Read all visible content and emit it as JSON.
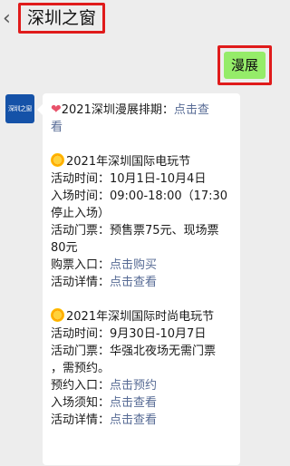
{
  "header": {
    "back_glyph": "‹",
    "title": "深圳之窗"
  },
  "outgoing": {
    "text": "漫展"
  },
  "avatar": {
    "label": "深圳之窗"
  },
  "message": {
    "intro_prefix": "2021深圳漫展排期：",
    "intro_link_part1": "点击查",
    "intro_link_part2": "看",
    "event1": {
      "title": "2021年深圳国际电玩节",
      "time": "活动时间：10月1日-10月4日",
      "entry_line1": "入场时间：09:00-18:00（17:30",
      "entry_line2": "停止入场）",
      "tickets_line1": "活动门票：预售票75元、现场票",
      "tickets_line2": "80元",
      "buy_label": "购票入口：",
      "buy_link": "点击购买",
      "detail_label": "活动详情：",
      "detail_link": "点击查看"
    },
    "event2": {
      "title": "2021年深圳国际时尚电玩节",
      "time": "活动时间：9月30日-10月7日",
      "tickets_line1": "活动门票：华强北夜场无需门票",
      "tickets_line2": "，需预约。",
      "reserve_label": "预约入口：",
      "reserve_link": "点击预约",
      "notice_label": "入场须知：",
      "notice_link": "点击查看",
      "detail_label": "活动详情：",
      "detail_link": "点击查看"
    }
  }
}
